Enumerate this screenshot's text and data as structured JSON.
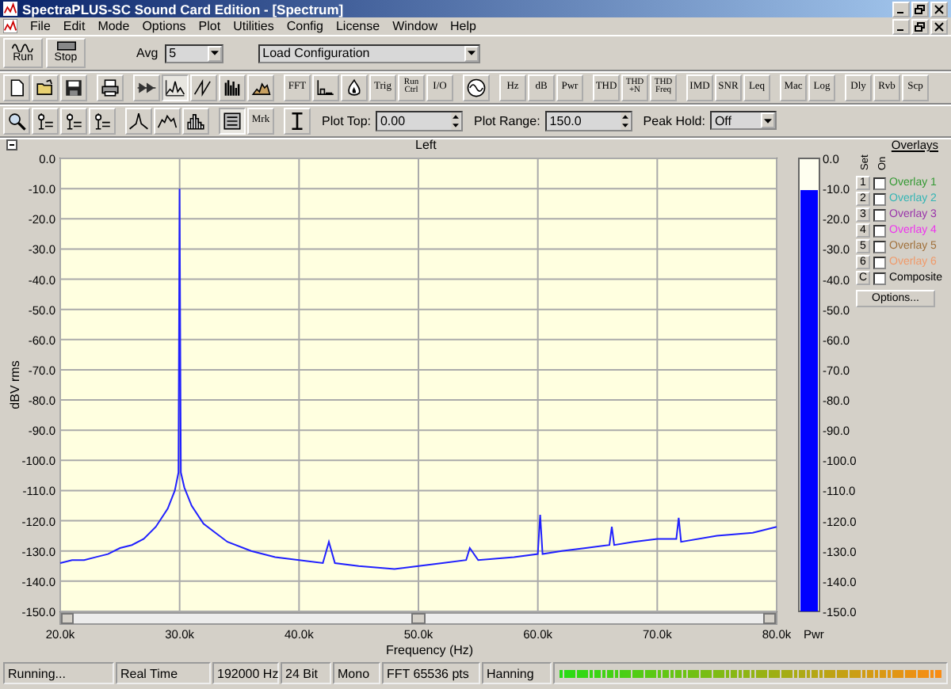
{
  "window": {
    "title": "SpectraPLUS-SC Sound Card Edition - [Spectrum]"
  },
  "menu": [
    "File",
    "Edit",
    "Mode",
    "Options",
    "Plot",
    "Utilities",
    "Config",
    "License",
    "Window",
    "Help"
  ],
  "toolbar_main": {
    "run": "Run",
    "stop": "Stop",
    "avg": {
      "label": "Avg",
      "value": "5"
    },
    "configuration": {
      "value": "Load Configuration"
    }
  },
  "toolbar_modes": [
    {
      "kind": "icon",
      "pressed": false
    },
    {
      "kind": "icon",
      "pressed": false
    },
    {
      "kind": "icon",
      "pressed": false
    },
    {
      "kind": "separator"
    },
    {
      "kind": "icon",
      "pressed": false
    },
    {
      "kind": "separator"
    },
    {
      "kind": "icon",
      "pressed": false
    },
    {
      "kind": "icon",
      "pressed": true
    },
    {
      "kind": "icon",
      "pressed": false
    },
    {
      "kind": "icon",
      "pressed": false
    },
    {
      "kind": "icon",
      "pressed": false
    },
    {
      "kind": "separator"
    },
    {
      "kind": "text",
      "label": "FFT",
      "pressed": false
    },
    {
      "kind": "icon",
      "pressed": false
    },
    {
      "kind": "icon",
      "pressed": false
    },
    {
      "kind": "text",
      "label": "Trig",
      "pressed": false
    },
    {
      "kind": "text",
      "label": "Run Ctrl",
      "pressed": false
    },
    {
      "kind": "text",
      "label": "I/O",
      "pressed": false
    },
    {
      "kind": "separator"
    },
    {
      "kind": "icon",
      "pressed": false
    },
    {
      "kind": "separator"
    },
    {
      "kind": "text",
      "label": "Hz",
      "pressed": false
    },
    {
      "kind": "text",
      "label": "dB",
      "pressed": false
    },
    {
      "kind": "text",
      "label": "Pwr",
      "pressed": false
    },
    {
      "kind": "separator"
    },
    {
      "kind": "text",
      "label": "THD",
      "pressed": false
    },
    {
      "kind": "text",
      "label": "THD +N",
      "pressed": false
    },
    {
      "kind": "text",
      "label": "THD Freq",
      "pressed": false
    },
    {
      "kind": "separator"
    },
    {
      "kind": "text",
      "label": "IMD",
      "pressed": false
    },
    {
      "kind": "text",
      "label": "SNR",
      "pressed": false
    },
    {
      "kind": "text",
      "label": "Leq",
      "pressed": false
    },
    {
      "kind": "separator"
    },
    {
      "kind": "text",
      "label": "Mac",
      "pressed": false
    },
    {
      "kind": "text",
      "label": "Log",
      "pressed": false
    },
    {
      "kind": "separator"
    },
    {
      "kind": "text",
      "label": "Dly",
      "pressed": false
    },
    {
      "kind": "text",
      "label": "Rvb",
      "pressed": false
    },
    {
      "kind": "text",
      "label": "Scp",
      "pressed": false
    }
  ],
  "toolbar_view": [
    {
      "kind": "icon",
      "pressed": false
    },
    {
      "kind": "icon",
      "pressed": false
    },
    {
      "kind": "icon",
      "pressed": false
    },
    {
      "kind": "icon",
      "pressed": false
    },
    {
      "kind": "separator"
    },
    {
      "kind": "icon",
      "pressed": false
    },
    {
      "kind": "icon",
      "pressed": false
    },
    {
      "kind": "icon",
      "pressed": false
    },
    {
      "kind": "separator"
    },
    {
      "kind": "icon",
      "pressed": true
    },
    {
      "kind": "text",
      "label": "Mrk",
      "pressed": false
    },
    {
      "kind": "separator"
    },
    {
      "kind": "icon",
      "pressed": false
    }
  ],
  "plot_top": {
    "label": "Plot Top:",
    "value": "0.00"
  },
  "plot_range": {
    "label": "Plot Range:",
    "value": "150.0"
  },
  "peak_hold": {
    "label": "Peak Hold:",
    "value": "Off"
  },
  "plot": {
    "chart_data": {
      "type": "line",
      "grid": true,
      "xlabel": "Frequency (Hz)",
      "ylabel": "dBV rms",
      "xlim": [
        20,
        80
      ],
      "ylim": [
        -150,
        0
      ],
      "xticks": [
        {
          "value": 20,
          "label": "20.0k"
        },
        {
          "value": 30,
          "label": "30.0k"
        },
        {
          "value": 40,
          "label": "40.0k"
        },
        {
          "value": 50,
          "label": "50.0k"
        },
        {
          "value": 60,
          "label": "60.0k"
        },
        {
          "value": 70,
          "label": "70.0k"
        },
        {
          "value": 80,
          "label": "80.0k"
        }
      ],
      "yticks": [
        {
          "value": 0,
          "label": "0.0"
        },
        {
          "value": -10,
          "label": "-10.0"
        },
        {
          "value": -20,
          "label": "-20.0"
        },
        {
          "value": -30,
          "label": "-30.0"
        },
        {
          "value": -40,
          "label": "-40.0"
        },
        {
          "value": -50,
          "label": "-50.0"
        },
        {
          "value": -60,
          "label": "-60.0"
        },
        {
          "value": -70,
          "label": "-70.0"
        },
        {
          "value": -80,
          "label": "-80.0"
        },
        {
          "value": -90,
          "label": "-90.0"
        },
        {
          "value": -100,
          "label": "-100.0"
        },
        {
          "value": -110,
          "label": "-110.0"
        },
        {
          "value": -120,
          "label": "-120.0"
        },
        {
          "value": -130,
          "label": "-130.0"
        },
        {
          "value": -140,
          "label": "-140.0"
        },
        {
          "value": -150,
          "label": "-150.0"
        }
      ],
      "x": [
        20,
        21,
        22,
        23,
        24,
        25,
        26,
        27,
        28,
        29,
        29.6,
        29.9,
        30,
        30.1,
        30.4,
        31,
        32,
        33,
        34,
        36,
        38,
        40,
        42,
        42.5,
        43,
        45,
        48,
        50,
        52,
        54,
        54.3,
        55,
        58,
        60,
        60.2,
        60.4,
        62,
        64,
        66,
        66.2,
        66.4,
        68,
        70,
        71.6,
        71.8,
        72,
        75,
        78,
        80
      ],
      "series": [
        {
          "name": "Left",
          "color": "#2020ff",
          "values": [
            -134,
            -133,
            -133,
            -132,
            -131,
            -129,
            -128,
            -126,
            -122,
            -116,
            -110,
            -104,
            -10,
            -104,
            -109,
            -115,
            -121,
            -124,
            -127,
            -130,
            -132,
            -133,
            -134,
            -127,
            -134,
            -135,
            -136,
            -135,
            -134,
            -133,
            -129,
            -133,
            -132,
            -131,
            -118,
            -131,
            -130,
            -129,
            -128,
            -122,
            -128,
            -127,
            -126,
            -126,
            -119,
            -127,
            -125,
            -124,
            -122
          ]
        }
      ]
    }
  },
  "power_meter": {
    "label": "Pwr",
    "level": 0.93,
    "scale": [
      "0.0",
      "-10.0",
      "-20.0",
      "-30.0",
      "-40.0",
      "-50.0",
      "-60.0",
      "-70.0",
      "-80.0",
      "-90.0",
      "-100.0",
      "-110.0",
      "-120.0",
      "-130.0",
      "-140.0",
      "-150.0"
    ]
  },
  "overlays": {
    "title": "Overlays",
    "set_header": "Set",
    "on_header": "On",
    "options_button": "Options...",
    "items": [
      {
        "key": "1",
        "name": "Overlay 1",
        "color": "#339933",
        "on": false
      },
      {
        "key": "2",
        "name": "Overlay 2",
        "color": "#33b5b5",
        "on": false
      },
      {
        "key": "3",
        "name": "Overlay 3",
        "color": "#9933aa",
        "on": false
      },
      {
        "key": "4",
        "name": "Overlay 4",
        "color": "#ee33ee",
        "on": false
      },
      {
        "key": "5",
        "name": "Overlay 5",
        "color": "#a0703a",
        "on": false
      },
      {
        "key": "6",
        "name": "Overlay 6",
        "color": "#f09a6a",
        "on": false
      },
      {
        "key": "C",
        "name": "Composite",
        "color": "#000000",
        "on": false
      }
    ]
  },
  "status_bar": {
    "fields": [
      "Running...",
      "Real Time",
      "192000 Hz",
      "24 Bit",
      "Mono",
      "FFT 65536 pts",
      "Hanning"
    ],
    "meter": {
      "level": 1
    }
  }
}
